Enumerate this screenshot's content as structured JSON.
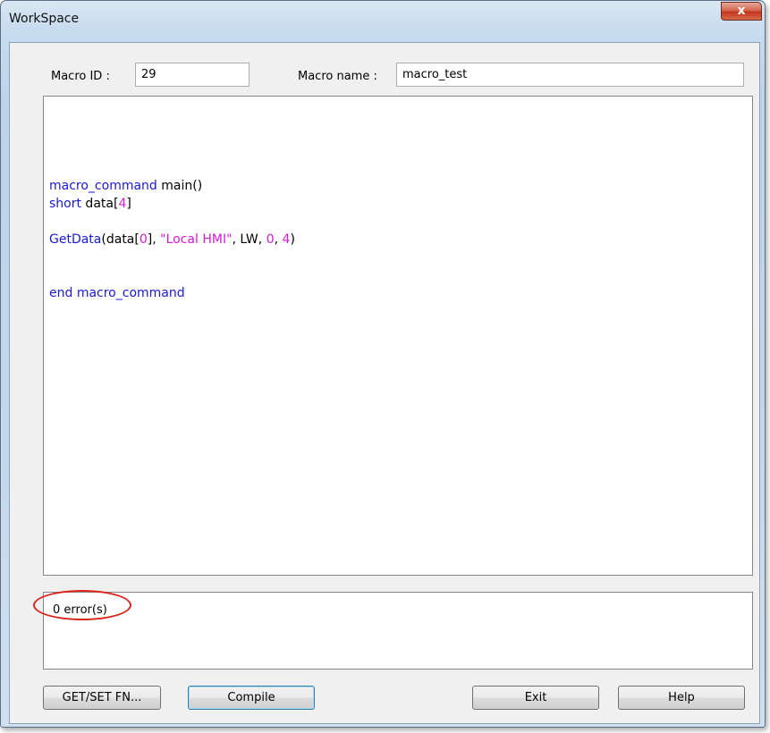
{
  "window": {
    "title": "WorkSpace",
    "close_glyph": "x"
  },
  "form": {
    "macro_id_label": "Macro ID :",
    "macro_id_value": "29",
    "macro_name_label": "Macro name :",
    "macro_name_value": "macro_test"
  },
  "editor": {
    "lines": [
      [],
      [],
      [
        {
          "t": "macro_command",
          "c": "kw"
        },
        {
          "t": " main()",
          "c": ""
        }
      ],
      [
        {
          "t": "short",
          "c": "kw"
        },
        {
          "t": " data[",
          "c": ""
        },
        {
          "t": "4",
          "c": "num"
        },
        {
          "t": "]",
          "c": ""
        }
      ],
      [],
      [
        {
          "t": "GetData",
          "c": "kw"
        },
        {
          "t": "(data[",
          "c": ""
        },
        {
          "t": "0",
          "c": "num"
        },
        {
          "t": "], ",
          "c": ""
        },
        {
          "t": "\"Local HMI\"",
          "c": "str"
        },
        {
          "t": ", LW, ",
          "c": ""
        },
        {
          "t": "0",
          "c": "num"
        },
        {
          "t": ", ",
          "c": ""
        },
        {
          "t": "4",
          "c": "num"
        },
        {
          "t": ")",
          "c": ""
        }
      ],
      [],
      [],
      [
        {
          "t": "end macro_command",
          "c": "kw"
        }
      ]
    ]
  },
  "output": {
    "status": "0 error(s)"
  },
  "buttons": {
    "get_set_fn": "GET/SET FN...",
    "compile": "Compile",
    "exit": "Exit",
    "help": "Help"
  },
  "colors": {
    "keyword": "#1a1ad6",
    "literal": "#d41ad4",
    "annotation": "#d9251b"
  }
}
